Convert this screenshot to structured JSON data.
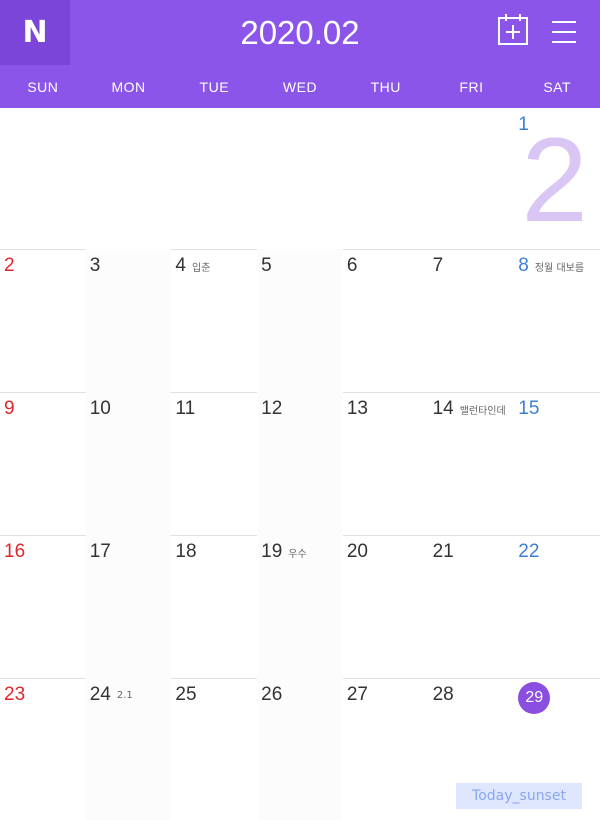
{
  "header": {
    "logo": "N",
    "title": "2020.02"
  },
  "weekdays": [
    "SUN",
    "MON",
    "TUE",
    "WED",
    "THU",
    "FRI",
    "SAT"
  ],
  "calendar": {
    "big_month_digit": "2",
    "weeks": [
      {
        "days": [
          {
            "d": "",
            "note": ""
          },
          {
            "d": "",
            "note": ""
          },
          {
            "d": "",
            "note": ""
          },
          {
            "d": "",
            "note": ""
          },
          {
            "d": "",
            "note": ""
          },
          {
            "d": "",
            "note": ""
          },
          {
            "d": "1",
            "note": ""
          }
        ]
      },
      {
        "days": [
          {
            "d": "2",
            "note": ""
          },
          {
            "d": "3",
            "note": ""
          },
          {
            "d": "4",
            "note": "입춘"
          },
          {
            "d": "5",
            "note": ""
          },
          {
            "d": "6",
            "note": ""
          },
          {
            "d": "7",
            "note": ""
          },
          {
            "d": "8",
            "note": "정월 대보름"
          }
        ]
      },
      {
        "days": [
          {
            "d": "9",
            "note": ""
          },
          {
            "d": "10",
            "note": ""
          },
          {
            "d": "11",
            "note": ""
          },
          {
            "d": "12",
            "note": ""
          },
          {
            "d": "13",
            "note": ""
          },
          {
            "d": "14",
            "note": "밸런타인데"
          },
          {
            "d": "15",
            "note": ""
          }
        ]
      },
      {
        "days": [
          {
            "d": "16",
            "note": ""
          },
          {
            "d": "17",
            "note": ""
          },
          {
            "d": "18",
            "note": ""
          },
          {
            "d": "19",
            "note": "우수"
          },
          {
            "d": "20",
            "note": ""
          },
          {
            "d": "21",
            "note": ""
          },
          {
            "d": "22",
            "note": ""
          }
        ]
      },
      {
        "days": [
          {
            "d": "23",
            "note": ""
          },
          {
            "d": "24",
            "note": "2.1"
          },
          {
            "d": "25",
            "note": ""
          },
          {
            "d": "26",
            "note": ""
          },
          {
            "d": "27",
            "note": ""
          },
          {
            "d": "28",
            "note": ""
          },
          {
            "d": "29",
            "note": ""
          }
        ]
      }
    ]
  },
  "watermark": "Today_sunset",
  "colors": {
    "accent": "#8a55e8",
    "sunday": "#e0262a",
    "saturday": "#3d7fd6",
    "today_circle": "#8a4fe0"
  }
}
